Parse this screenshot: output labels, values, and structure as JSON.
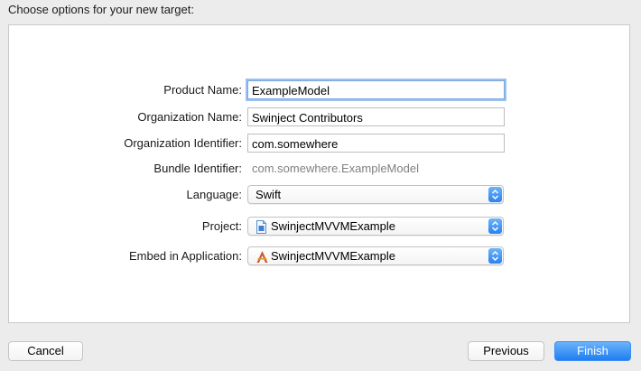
{
  "dialog": {
    "title": "Choose options for your new target:"
  },
  "form": {
    "product_name": {
      "label": "Product Name:",
      "value": "ExampleModel"
    },
    "organization_name": {
      "label": "Organization Name:",
      "value": "Swinject Contributors"
    },
    "organization_identifier": {
      "label": "Organization Identifier:",
      "value": "com.somewhere"
    },
    "bundle_identifier": {
      "label": "Bundle Identifier:",
      "value": "com.somewhere.ExampleModel"
    },
    "language": {
      "label": "Language:",
      "value": "Swift"
    },
    "project": {
      "label": "Project:",
      "value": "SwinjectMVVMExample",
      "icon": "project-file-icon"
    },
    "embed_in_application": {
      "label": "Embed in Application:",
      "value": "SwinjectMVVMExample",
      "icon": "app-icon"
    }
  },
  "buttons": {
    "cancel": "Cancel",
    "previous": "Previous",
    "finish": "Finish"
  },
  "colors": {
    "accent": "#2a83f3",
    "focus_ring": "#9cc1f0",
    "window_bg": "#ececec"
  }
}
